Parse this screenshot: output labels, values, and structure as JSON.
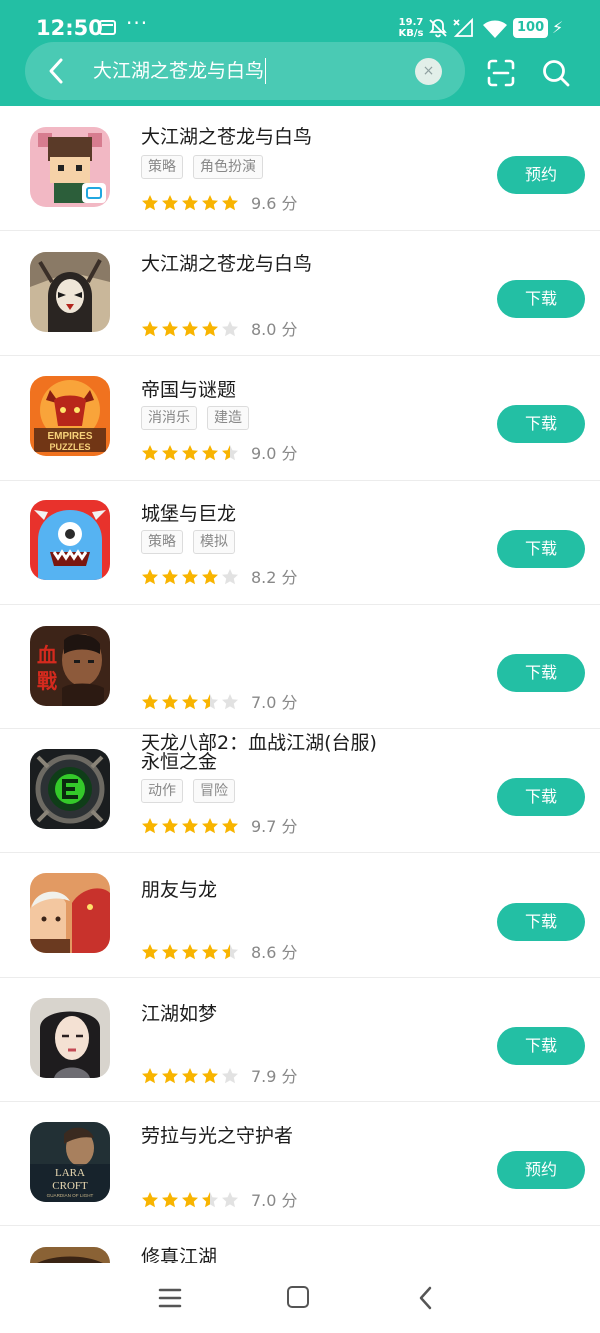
{
  "status_bar": {
    "time": "12:50",
    "more": "···",
    "net_speed_value": "19.7",
    "net_speed_unit": "KB/s",
    "battery": "100"
  },
  "search": {
    "query": "大江湖之苍龙与白鸟",
    "clear_label": "×"
  },
  "colors": {
    "accent": "#23bfa4",
    "star_full": "#f8b400",
    "star_empty": "#e2e2e2"
  },
  "apps": [
    {
      "name": "大江湖之苍龙与白鸟",
      "tags": [
        "策略",
        "角色扮演"
      ],
      "rating": 5,
      "score": "9.6 分",
      "action": "预约",
      "icon": "pixel-hero-icon"
    },
    {
      "name": "大江湖之苍龙与白鸟",
      "tags": [],
      "rating": 4,
      "score": "8.0 分",
      "action": "下载",
      "icon": "opera-warrior-icon"
    },
    {
      "name": "帝国与谜题",
      "tags": [
        "消消乐",
        "建造"
      ],
      "rating": 4.5,
      "score": "9.0 分",
      "action": "下载",
      "icon": "red-dragon-icon"
    },
    {
      "name": "城堡与巨龙",
      "tags": [
        "策略",
        "模拟"
      ],
      "rating": 4,
      "score": "8.2 分",
      "action": "下载",
      "icon": "blue-monster-icon"
    },
    {
      "name": "天龙八部2：血战江湖(台服)",
      "tags": [],
      "rating": 3.5,
      "score": "7.0 分",
      "action": "下载",
      "icon": "blood-war-icon"
    },
    {
      "name": "永恒之金",
      "tags": [
        "动作",
        "冒险"
      ],
      "rating": 5,
      "score": "9.7 分",
      "action": "下载",
      "icon": "green-rune-icon"
    },
    {
      "name": "朋友与龙",
      "tags": [],
      "rating": 4.5,
      "score": "8.6 分",
      "action": "下载",
      "icon": "dragon-friend-icon"
    },
    {
      "name": "江湖如梦",
      "tags": [],
      "rating": 4,
      "score": "7.9 分",
      "action": "下载",
      "icon": "swordswoman-icon"
    },
    {
      "name": "劳拉与光之守护者",
      "tags": [],
      "rating": 3.5,
      "score": "7.0 分",
      "action": "预约",
      "icon": "lara-croft-icon"
    },
    {
      "name": "修真江湖",
      "tags": [],
      "rating": 0,
      "score": "",
      "action": "",
      "icon": "xiuzhen-icon"
    }
  ],
  "icon_text": {
    "lara_line1": "LARA",
    "lara_line2": "CROFT",
    "lara_line3": "GUARDIAN OF LIGHT",
    "empires_line1": "EMPIRES",
    "empires_line2": "PUZZLES",
    "blood_glyph1": "血",
    "blood_glyph2": "戰"
  }
}
